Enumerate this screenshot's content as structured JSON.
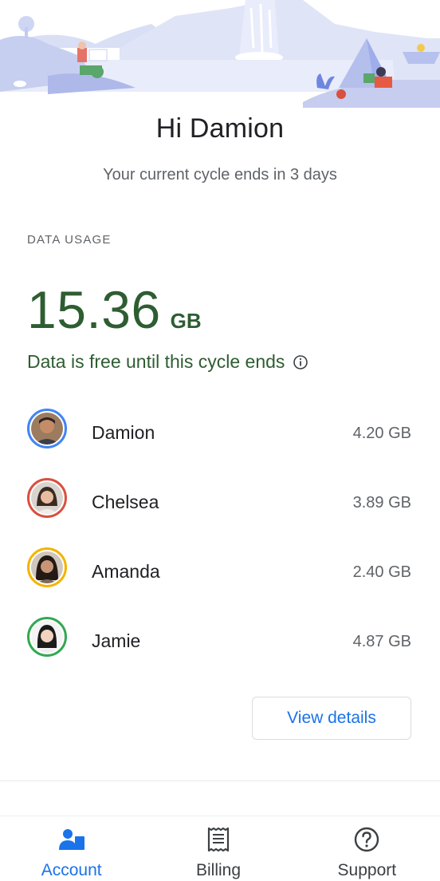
{
  "header": {
    "greeting": "Hi Damion",
    "cycle_text": "Your current cycle ends in 3 days"
  },
  "data_usage": {
    "section_label": "DATA USAGE",
    "total_value": "15.36",
    "total_unit": "GB",
    "note": "Data is free until this cycle ends",
    "members": [
      {
        "name": "Damion",
        "usage": "4.20 GB",
        "ring_color": "#4285f4"
      },
      {
        "name": "Chelsea",
        "usage": "3.89 GB",
        "ring_color": "#d9503f"
      },
      {
        "name": "Amanda",
        "usage": "2.40 GB",
        "ring_color": "#f4b400"
      },
      {
        "name": "Jamie",
        "usage": "4.87 GB",
        "ring_color": "#34a853"
      }
    ],
    "view_details_label": "View details"
  },
  "bottom_nav": {
    "items": [
      {
        "label": "Account",
        "icon": "account-icon",
        "active": true
      },
      {
        "label": "Billing",
        "icon": "receipt-icon",
        "active": false
      },
      {
        "label": "Support",
        "icon": "help-circle-icon",
        "active": false
      }
    ]
  },
  "colors": {
    "accent": "#1a73e8",
    "usage_green": "#2e5d32"
  }
}
